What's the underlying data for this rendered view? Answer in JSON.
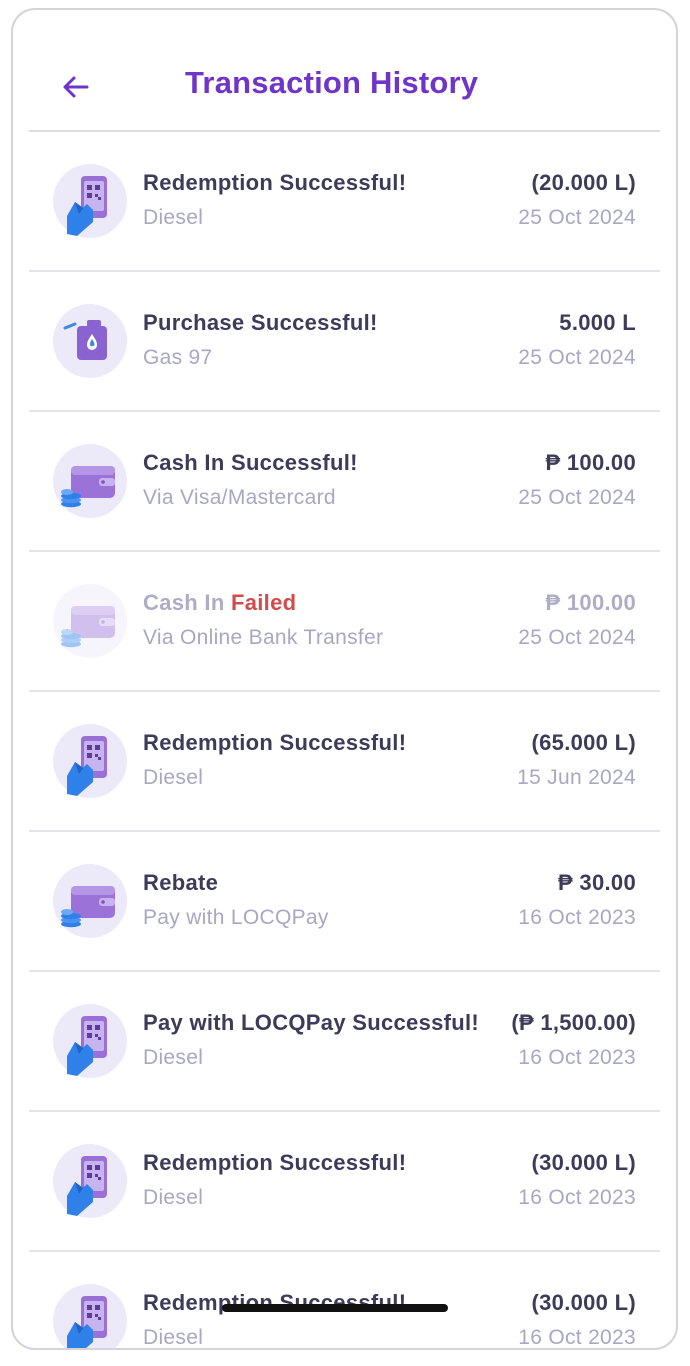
{
  "header": {
    "title": "Transaction History",
    "back_icon": "arrow-left-icon"
  },
  "colors": {
    "accent": "#6f34c8",
    "failed": "#d24a4a",
    "title_text": "#3d3b59",
    "muted_text": "#a9a7c2"
  },
  "transactions": [
    {
      "icon": "phone-qr-hand-icon",
      "title": "Redemption Successful!",
      "subtitle": "Diesel",
      "amount": "(20.000 L)",
      "date": "25 Oct 2024"
    },
    {
      "icon": "fuel-jerrycan-icon",
      "title": "Purchase Successful!",
      "subtitle": "Gas 97",
      "amount": "5.000 L",
      "date": "25 Oct 2024"
    },
    {
      "icon": "wallet-coins-icon",
      "title": "Cash In Successful!",
      "subtitle": "Via Visa/Mastercard",
      "amount": "₱ 100.00",
      "date": "25 Oct 2024"
    },
    {
      "icon": "wallet-coins-icon",
      "title_prefix": "Cash In",
      "title_status": "Failed",
      "subtitle": "Via Online Bank Transfer",
      "amount": "₱ 100.00",
      "date": "25 Oct 2024"
    },
    {
      "icon": "phone-qr-hand-icon",
      "title": "Redemption Successful!",
      "subtitle": "Diesel",
      "amount": "(65.000 L)",
      "date": "15 Jun 2024"
    },
    {
      "icon": "wallet-coins-icon",
      "title": "Rebate",
      "subtitle": "Pay with LOCQPay",
      "amount": "₱ 30.00",
      "date": "16 Oct 2023"
    },
    {
      "icon": "phone-qr-hand-icon",
      "title": "Pay with LOCQPay Successful!",
      "subtitle": "Diesel",
      "amount": "(₱ 1,500.00)",
      "date": "16 Oct 2023"
    },
    {
      "icon": "phone-qr-hand-icon",
      "title": "Redemption Successful!",
      "subtitle": "Diesel",
      "amount": "(30.000 L)",
      "date": "16 Oct 2023"
    },
    {
      "icon": "phone-qr-hand-icon",
      "title": "Redemption Successful!",
      "subtitle": "Diesel",
      "amount": "(30.000 L)",
      "date": "16 Oct 2023"
    }
  ]
}
